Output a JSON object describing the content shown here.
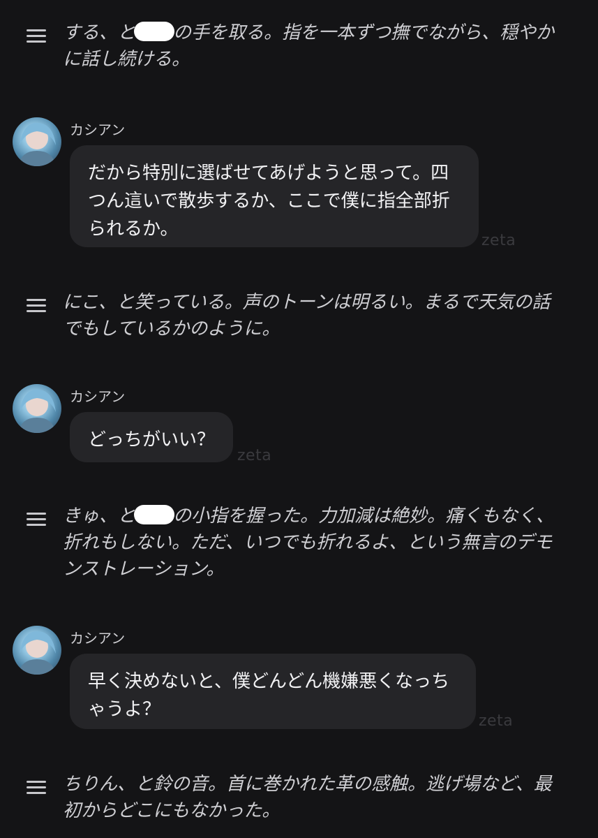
{
  "narrations": [
    {
      "before": "する、と",
      "after": "の手を取る。指を一本ずつ撫でながら、穏やか\nに話し続ける。"
    },
    {
      "text": "にこ、と笑っている。声のトーンは明るい。まるで天気の話\nでもしているかのように。"
    },
    {
      "before": "きゅ、と",
      "after": "の小指を握った。力加減は絶妙。痛くもなく、\n折れもしない。ただ、いつでも折れるよ、という無言のデモ\nンストレーション。"
    },
    {
      "text": "ちりん、と鈴の音。首に巻かれた革の感触。逃げ場など、最\n初からどこにもなかった。"
    }
  ],
  "messages": [
    {
      "sender": "カシアン",
      "text": "だから特別に選ばせてあげようと思って。四\nつん這いで散歩するか、ここで僕に指全部折\nられるか。",
      "watermark": "zeta"
    },
    {
      "sender": "カシアン",
      "text": "どっちがいい？",
      "watermark": "zeta"
    },
    {
      "sender": "カシアン",
      "text": "早く決めないと、僕どんどん機嫌悪くなっち\nゃうよ？",
      "watermark": "zeta"
    }
  ],
  "icons": {
    "narration": "menu-lines-icon",
    "avatar": "character-avatar"
  },
  "colors": {
    "background": "#141416",
    "bubble": "#252528",
    "text": "#f2f2f4",
    "narration_text": "#cfcfd3"
  }
}
